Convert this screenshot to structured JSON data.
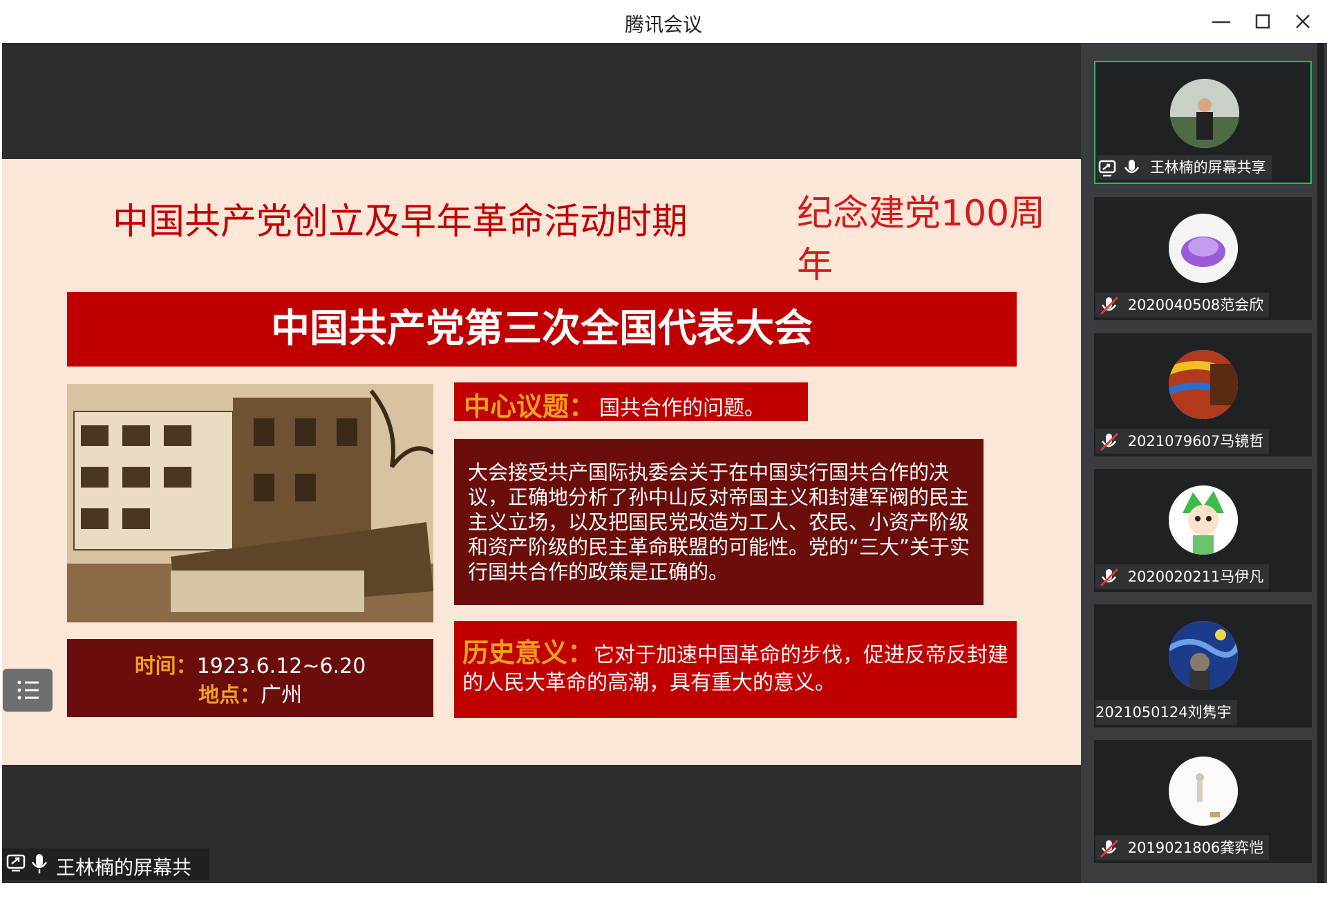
{
  "window": {
    "title": "腾讯会议"
  },
  "slide": {
    "period_title": "中国共产党创立及早年革命活动时期",
    "centenary": "纪念建党100周年",
    "banner": "中国共产党第三次全国代表大会",
    "topic_label": "中心议题：",
    "topic_value": "国共合作的问题。",
    "description": "大会接受共产国际执委会关于在中国实行国共合作的决议，正确地分析了孙中山反对帝国主义和封建军阀的民主主义立场，以及把国民党改造为工人、农民、小资产阶级和资产阶级的民主革命联盟的可能性。党的“三大”关于实行国共合作的政策是正确的。",
    "time_label": "时间：",
    "time_value": "1923.6.12~6.20",
    "place_label": "地点：",
    "place_value": "广州",
    "significance_label": "历史意义：",
    "significance_text": "它对于加速中国革命的步伐，促进反帝反封建的人民大革命的高潮，具有重大的意义。"
  },
  "share_badge": {
    "label": "王林楠的屏幕共享"
  },
  "participants": [
    {
      "name": "王林楠的屏幕共享",
      "mic": "on",
      "sharing": true,
      "active": true,
      "avatar": "photo-person"
    },
    {
      "name": "2020040508范会欣",
      "mic": "muted",
      "sharing": false,
      "active": false,
      "avatar": "purple-shell"
    },
    {
      "name": "2021079607马镜哲",
      "mic": "muted",
      "sharing": false,
      "active": false,
      "avatar": "abstract-painting"
    },
    {
      "name": "2020020211马伊凡",
      "mic": "muted",
      "sharing": false,
      "active": false,
      "avatar": "cartoon-green"
    },
    {
      "name": "2021050124刘隽宇",
      "mic": "none",
      "sharing": false,
      "active": false,
      "avatar": "starry-night"
    },
    {
      "name": "2019021806龚弈恺",
      "mic": "muted",
      "sharing": false,
      "active": false,
      "avatar": "white-figure"
    }
  ],
  "colors": {
    "slide_bg": "#fce6d8",
    "red": "#c00000",
    "dark_red": "#6b0d0a",
    "orange": "#f0a020",
    "active_border": "#1fbf5f"
  }
}
